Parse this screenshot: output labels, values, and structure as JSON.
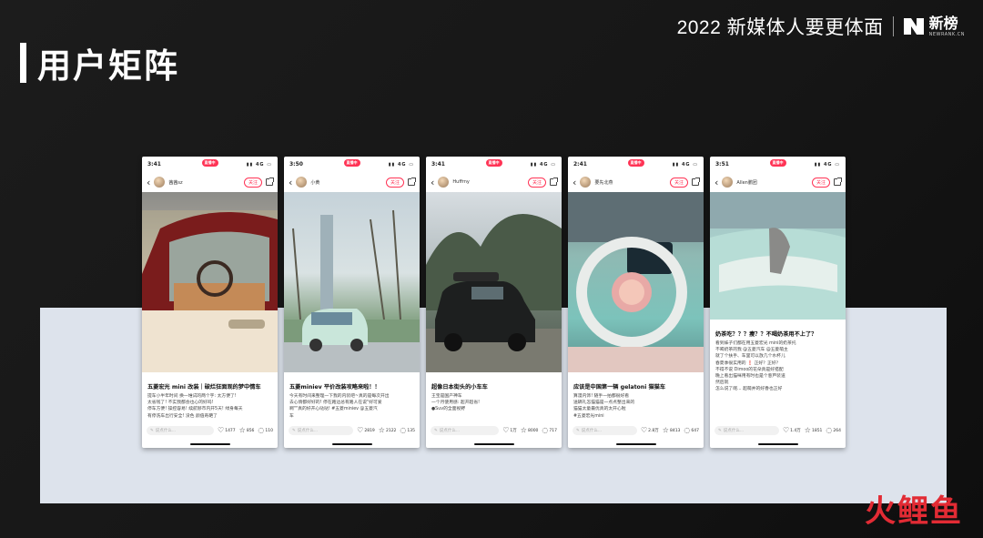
{
  "header": {
    "slogan": "2022 新媒体人要更体面",
    "brand_name": "新榜",
    "brand_site": "NEWRANK.CN"
  },
  "page_title": "用户矩阵",
  "watermark": "火鲤鱼",
  "phones": [
    {
      "time": "3:41",
      "pill": "直播中",
      "author": "茜茜sz",
      "follow": "关注",
      "caption": "五菱宏光 mini 改装｜破烂狂面观的梦中情车",
      "body": [
        "提车小半年时间 换一堆试的两个字: 太方便了!",
        "太省钱了! 不实我都会也心的好吗!",
        "停车方便! 操控容易! 续航够市内开5天! 绿身每天",
        "有停洗车出行安全! 没色 颜值奇葩了"
      ],
      "input": "说点什么...",
      "likes": "1477",
      "stars": "856",
      "comments": "110"
    },
    {
      "time": "3:50",
      "pill": "直播中",
      "author": "小黄",
      "follow": "关注",
      "caption": "五菱miniev 平价改装攻略来啦！！",
      "body": [
        "今天有时间来整理一下我的内装吧~真的是每次开出",
        "去心情都好好的! 停在路边总有路人在说\"好可爱",
        "啊\"\"真的好开心哒哒! #五菱miniev @五菱汽",
        "车"
      ],
      "input": "说点什么...",
      "likes": "2819",
      "stars": "2122",
      "comments": "135"
    },
    {
      "time": "3:41",
      "pill": "直播中",
      "author": "Huffrny",
      "follow": "关注",
      "caption": "超像日本街头的小车车",
      "body": [
        "王宝是国产神车",
        "一个月使用感: 超开超省!",
        "●Suv的全面视野",
        ""
      ],
      "input": "说点什么...",
      "likes": "1万",
      "stars": "8000",
      "comments": "717"
    },
    {
      "time": "2:41",
      "pill": "直播中",
      "author": "要先北燕",
      "follow": "关注",
      "caption": "应该是中国第一辆 gelatoni 猫猫车",
      "body": [
        "算漫内饰! 随手一拍都很好看",
        "送辆礼怎猫猫是一点点整出来的",
        "猫猫太童最优真的太开心啦",
        "#五菱宏光mini"
      ],
      "input": "说点什么...",
      "likes": "2.8万",
      "stars": "8413",
      "comments": "647"
    },
    {
      "time": "3:51",
      "pill": "直播中",
      "author": "Allen鹏团",
      "follow": "关注",
      "caption": "奶茶吃？？？瘦？？不喝奶茶用不上了？",
      "body": [
        "看到妹子们都在用五菱宏光 mini的奶茶托",
        "不喝奶茶的我 @五菱汽车 @五菱萌主",
        "就了个扶手、车里可以放几个水杯儿",
        "春夏季很实用的 ❗ 正好？正好？",
        "不得不说 Dimoo的花朵真是好搭配",
        "",
        "晚上看出猫咪用有时也是个葱芦装道",
        "然后就",
        "怎么说了呢... 超萌并的好香也正好"
      ],
      "input": "说点什么...",
      "likes": "1.4万",
      "stars": "1851",
      "comments": "264"
    }
  ]
}
